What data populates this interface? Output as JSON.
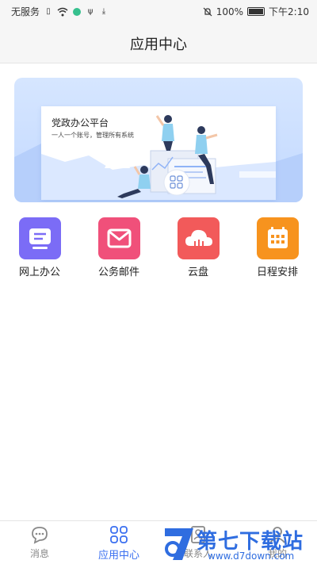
{
  "status_bar": {
    "carrier": "无服务",
    "battery": "100%",
    "time": "下午2:10"
  },
  "header": {
    "title": "应用中心"
  },
  "banner": {
    "title": "党政办公平台",
    "subtitle": "一人一个账号，管理所有系统"
  },
  "apps": [
    {
      "label": "网上办公",
      "icon": "document-icon",
      "color": "#7b6cf6"
    },
    {
      "label": "公务邮件",
      "icon": "mail-icon",
      "color": "#f0507a"
    },
    {
      "label": "云盘",
      "icon": "cloud-icon",
      "color": "#f25a5a"
    },
    {
      "label": "日程安排",
      "icon": "calendar-icon",
      "color": "#f7931e"
    }
  ],
  "bottom_nav": {
    "items": [
      {
        "label": "消息",
        "icon": "chat-icon"
      },
      {
        "label": "应用中心",
        "icon": "apps-icon",
        "active": true
      },
      {
        "label": "联系人",
        "icon": "contacts-icon"
      },
      {
        "label": "我的",
        "icon": "profile-icon"
      }
    ]
  },
  "watermark": {
    "text": "第七下载站",
    "url": "www.d7down.com"
  },
  "colors": {
    "accent": "#3a6ff0",
    "banner_bg": "#c9ddff"
  }
}
